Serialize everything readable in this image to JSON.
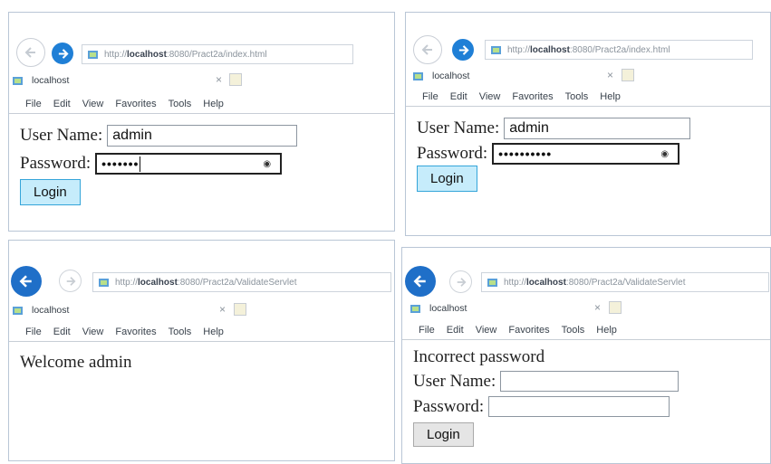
{
  "panels": [
    {
      "url_prefix": "http://",
      "url_host": "localhost",
      "url_rest": ":8080/Pract2a/index.html",
      "tab_title": "localhost",
      "tab_close": "×",
      "menu": [
        "File",
        "Edit",
        "View",
        "Favorites",
        "Tools",
        "Help"
      ],
      "username_label": "User Name:",
      "username_value": "admin",
      "password_label": "Password:",
      "password_mask": "•••••••",
      "login_label": "Login"
    },
    {
      "url_prefix": "http://",
      "url_host": "localhost",
      "url_rest": ":8080/Pract2a/index.html",
      "tab_title": "localhost",
      "tab_close": "×",
      "menu": [
        "File",
        "Edit",
        "View",
        "Favorites",
        "Tools",
        "Help"
      ],
      "username_label": "User Name:",
      "username_value": "admin",
      "password_label": "Password:",
      "password_mask": "••••••••••",
      "login_label": "Login"
    },
    {
      "url_prefix": "http://",
      "url_host": "localhost",
      "url_rest": ":8080/Pract2a/ValidateServlet",
      "tab_title": "localhost",
      "tab_close": "×",
      "menu": [
        "File",
        "Edit",
        "View",
        "Favorites",
        "Tools",
        "Help"
      ],
      "message": "Welcome admin"
    },
    {
      "url_prefix": "http://",
      "url_host": "localhost",
      "url_rest": ":8080/Pract2a/ValidateServlet",
      "tab_title": "localhost",
      "tab_close": "×",
      "menu": [
        "File",
        "Edit",
        "View",
        "Favorites",
        "Tools",
        "Help"
      ],
      "message": "Incorrect password",
      "username_label": "User Name:",
      "username_value": "",
      "password_label": "Password:",
      "password_value": "",
      "login_label": "Login"
    }
  ]
}
